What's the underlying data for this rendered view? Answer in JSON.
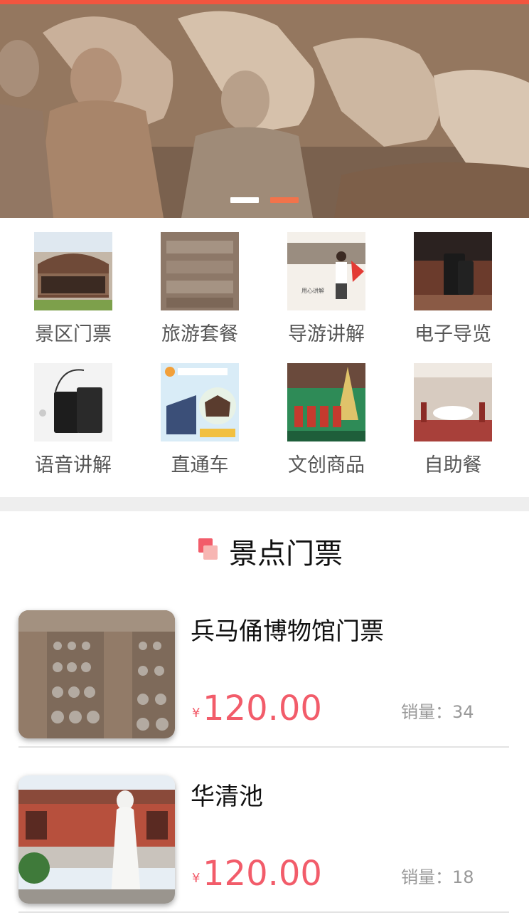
{
  "banner": {
    "image": "terracotta-warriors-and-horses-photo",
    "slides": 2,
    "active_slide": 2
  },
  "categories": [
    {
      "label": "景区门票",
      "image": "museum-building-photo"
    },
    {
      "label": "旅游套餐",
      "image": "warrior-pits-photo"
    },
    {
      "label": "导游讲解",
      "image": "guide-with-flag-photo"
    },
    {
      "label": "电子导览",
      "image": "audio-device-photo"
    },
    {
      "label": "语音讲解",
      "image": "earphone-device-photo"
    },
    {
      "label": "直通车",
      "image": "shuttle-bus-poster"
    },
    {
      "label": "文创商品",
      "image": "souvenir-figures-photo"
    },
    {
      "label": "自助餐",
      "image": "dining-hall-photo"
    }
  ],
  "section": {
    "title": "景点门票"
  },
  "products": [
    {
      "name": "兵马俑博物馆门票",
      "currency": "¥",
      "price": "120.00",
      "sales": "销量：34",
      "image": "terracotta-army-pit-photo"
    },
    {
      "name": "华清池",
      "currency": "¥",
      "price": "120.00",
      "sales": "销量：18",
      "image": "huaqing-pool-statue-photo"
    }
  ],
  "colors": {
    "accent": "#f25c6a",
    "top_strip": "#f2553f",
    "active_dot": "#f2734b"
  }
}
